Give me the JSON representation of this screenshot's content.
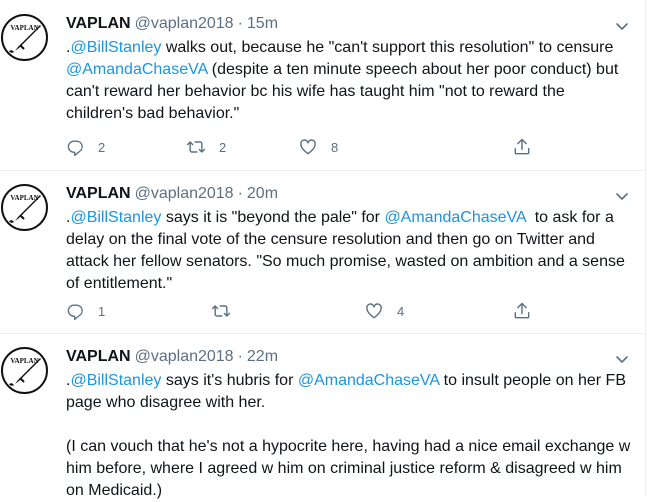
{
  "tweets": [
    {
      "name": "VAPLAN",
      "handle": "@vaplan2018",
      "dot": "·",
      "time": "15m",
      "avatar_text": "VAPLAN",
      "body": [
        [
          {
            "t": "."
          },
          {
            "t": "@BillStanley",
            "mention": true
          },
          {
            "t": " walks out, because he \"can't support this resolution\" to censure "
          },
          {
            "t": "@AmandaChaseVA",
            "mention": true
          },
          {
            "t": " (despite a ten minute speech about her poor conduct) but can't reward her behavior bc his wife has taught him \"not to reward the children's bad behavior.\""
          }
        ]
      ],
      "reply_count": "2",
      "retweet_count": "2",
      "like_count": "8"
    },
    {
      "name": "VAPLAN",
      "handle": "@vaplan2018",
      "dot": "·",
      "time": "20m",
      "avatar_text": "VAPLAN",
      "body": [
        [
          {
            "t": "."
          },
          {
            "t": "@BillStanley",
            "mention": true
          },
          {
            "t": " says it is \"beyond the pale\" for "
          },
          {
            "t": "@AmandaChaseVA",
            "mention": true
          },
          {
            "t": "  to ask for a delay on the final vote of the censure resolution and then go on Twitter and attack her fellow senators. \"So much promise, wasted on ambition and a sense of entitlement.\""
          }
        ]
      ],
      "reply_count": "1",
      "retweet_count": "",
      "like_count": "4"
    },
    {
      "name": "VAPLAN",
      "handle": "@vaplan2018",
      "dot": "·",
      "time": "22m",
      "avatar_text": "VAPLAN",
      "body": [
        [
          {
            "t": "."
          },
          {
            "t": "@BillStanley",
            "mention": true
          },
          {
            "t": " says it's hubris for "
          },
          {
            "t": "@AmandaChaseVA",
            "mention": true
          },
          {
            "t": " to insult people on her FB page who disagree with her."
          }
        ],
        [
          {
            "t": "(I can vouch that he's not a hypocrite here, having had a nice email exchange w him before, where I agreed w him on criminal justice reform & disagreed w him on Medicaid.)"
          }
        ]
      ],
      "reply_count": "",
      "retweet_count": "",
      "like_count": ""
    }
  ],
  "colors": {
    "text": "#0f1419",
    "secondary": "#5b7083",
    "mention": "#1b95e0",
    "divider": "#ebeef0"
  },
  "icons": {
    "reply": "reply-icon",
    "retweet": "retweet-icon",
    "like": "like-icon",
    "share": "share-icon",
    "more": "chevron-down-icon"
  }
}
